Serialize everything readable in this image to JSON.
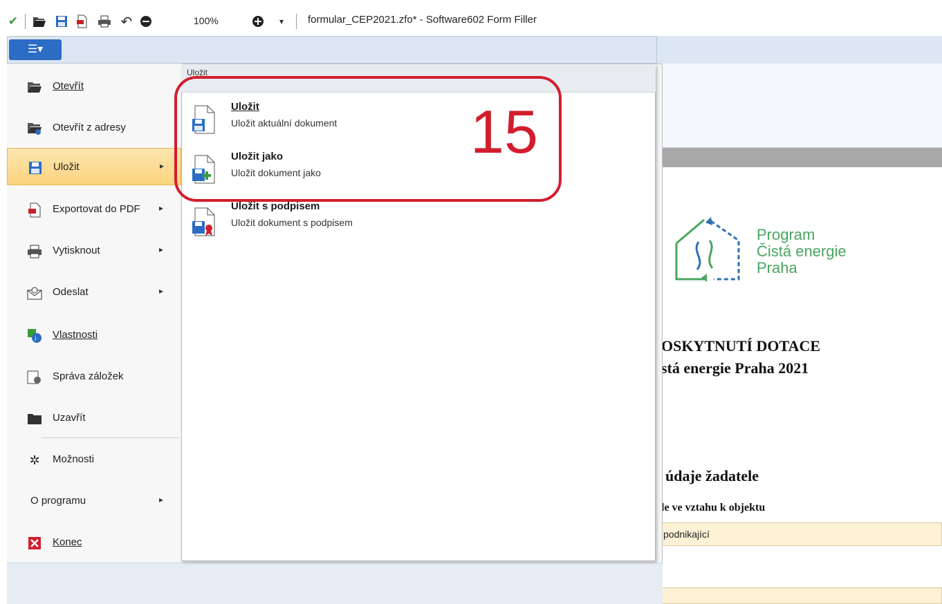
{
  "titlebar": {
    "zoom": "100%",
    "title": "formular_CEP2021.zfo* - Software602 Form Filler",
    "icons": [
      "check-icon",
      "open-folder-icon",
      "save-icon",
      "pdf-export-icon",
      "print-icon",
      "undo-icon",
      "zoom-out-icon",
      "zoom-in-icon",
      "dropdown-icon"
    ]
  },
  "menu": {
    "items": [
      {
        "label": "Otevřít",
        "icon": "open-folder-icon",
        "arrow": ""
      },
      {
        "label": "Otevřít z adresy",
        "icon": "open-url-icon",
        "arrow": ""
      },
      {
        "label": "Uložit",
        "icon": "save-icon",
        "arrow": "▸"
      },
      {
        "label": "Exportovat do PDF",
        "icon": "pdf-export-icon",
        "arrow": "▸"
      },
      {
        "label": "Vytisknout",
        "icon": "print-icon",
        "arrow": "▸"
      },
      {
        "label": "Odeslat",
        "icon": "send-icon",
        "arrow": "▸"
      },
      {
        "label": "Vlastnosti",
        "icon": "properties-icon",
        "arrow": ""
      },
      {
        "label": "Správa záložek",
        "icon": "bookmarks-icon",
        "arrow": ""
      },
      {
        "label": "Uzavřít",
        "icon": "close-folder-icon",
        "arrow": ""
      },
      {
        "label": "Možnosti",
        "icon": "gear-icon",
        "arrow": ""
      },
      {
        "label": "O programu",
        "icon": "",
        "arrow": "▸"
      },
      {
        "label": "Konec",
        "icon": "exit-icon",
        "arrow": ""
      }
    ]
  },
  "submenu": {
    "header": "Uložit",
    "items": [
      {
        "title": "Uložit",
        "desc": "Uložit aktuální dokument"
      },
      {
        "title": "Uložit jako",
        "desc": "Uložit dokument jako"
      },
      {
        "title": "Uložit s podpisem",
        "desc": "Uložit dokument s podpisem"
      }
    ]
  },
  "annotation": {
    "step": "15",
    "color": "#d11e2e"
  },
  "document": {
    "program_lines": [
      "Program",
      "Čistá energie",
      "Praha"
    ],
    "heading1": "OSKYTNUTÍ DOTACE",
    "heading2": "stá energie Praha 2021",
    "heading3": "údaje žadatele",
    "heading4": "le ve vztahu k objektu",
    "field1_value": "podnikající"
  },
  "colors": {
    "accent": "#2b6cc4",
    "active_item": "#fbd37c",
    "logo_green": "#4aa55f",
    "logo_blue": "#2f6fb3"
  }
}
